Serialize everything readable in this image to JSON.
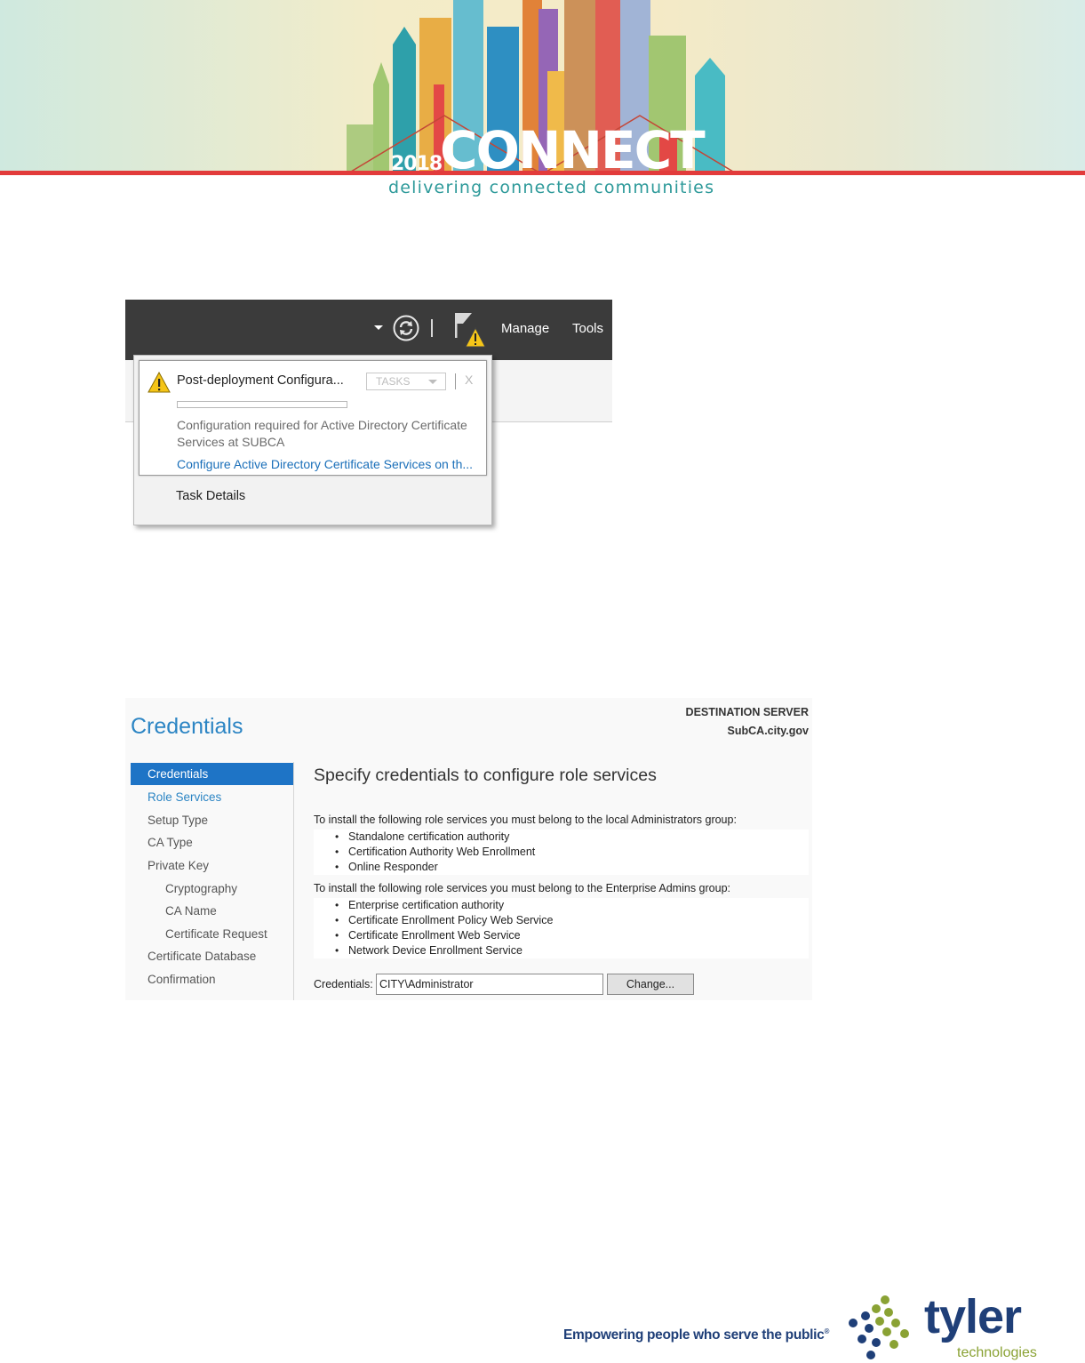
{
  "banner": {
    "year": "2018",
    "word": "CONNECT",
    "tagline": "delivering connected communities"
  },
  "server_manager": {
    "menu_manage": "Manage",
    "menu_tools": "Tools",
    "notification": {
      "title": "Post-deployment Configura...",
      "tasks_label": "TASKS",
      "close_label": "X",
      "progress_fraction": 0.0,
      "message": "Configuration required for Active Directory Certificate Services at SUBCA",
      "link": "Configure Active Directory Certificate Services on th..."
    },
    "task_details": "Task Details"
  },
  "wizard": {
    "title": "Credentials",
    "destination_label": "DESTINATION SERVER",
    "destination_value": "SubCA.city.gov",
    "nav": [
      {
        "label": "Credentials"
      },
      {
        "label": "Role Services"
      },
      {
        "label": "Setup Type"
      },
      {
        "label": "CA Type"
      },
      {
        "label": "Private Key"
      },
      {
        "label": "Cryptography"
      },
      {
        "label": "CA Name"
      },
      {
        "label": "Certificate Request"
      },
      {
        "label": "Certificate Database"
      },
      {
        "label": "Confirmation"
      }
    ],
    "heading": "Specify credentials to configure role services",
    "local_admins_text": "To install the following role services you must belong to the local Administrators group:",
    "local_admins_roles": [
      "Standalone certification authority",
      "Certification Authority Web Enrollment",
      "Online Responder"
    ],
    "enterprise_admins_text": "To install the following role services you must belong to the Enterprise Admins group:",
    "enterprise_admins_roles": [
      "Enterprise certification authority",
      "Certificate Enrollment Policy Web Service",
      "Certificate Enrollment Web Service",
      "Network Device Enrollment Service"
    ],
    "credentials_label": "Credentials:",
    "credentials_value": "CITY\\Administrator",
    "change_button": "Change..."
  },
  "footer": {
    "tagline": "Empowering people who serve the public",
    "reg_mark": "®",
    "logo": "tyler",
    "logo_sub": "technologies"
  },
  "colors": {
    "accent_blue": "#1e74c6",
    "link_blue": "#2c85c4",
    "banner_red": "#e23b3b",
    "footer_navy": "#1f3f78",
    "footer_green": "#8aa234"
  }
}
